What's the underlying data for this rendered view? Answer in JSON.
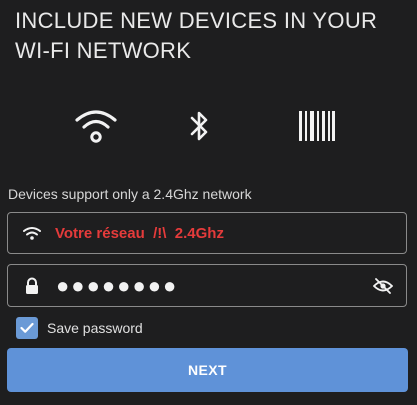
{
  "header": {
    "title": "INCLUDE NEW DEVICES IN YOUR WI-FI NETWORK"
  },
  "methods": [
    {
      "name": "wifi",
      "icon": "wifi-icon"
    },
    {
      "name": "bluetooth",
      "icon": "bluetooth-icon"
    },
    {
      "name": "barcode",
      "icon": "barcode-icon"
    }
  ],
  "form": {
    "hint": "Devices support only a 2.4Ghz network",
    "ssid": {
      "value": "Votre réseau  /!\\  2.4Ghz",
      "icon": "wifi-icon"
    },
    "password": {
      "value": "●●●●●●●●",
      "lead_icon": "lock-icon",
      "toggle_icon": "eye-off-icon"
    },
    "save_password": {
      "label": "Save password",
      "checked": true
    },
    "next_label": "NEXT"
  },
  "colors": {
    "background": "#1e1e1f",
    "accent": "#5f92d8",
    "warning_text": "#e53b3b"
  }
}
